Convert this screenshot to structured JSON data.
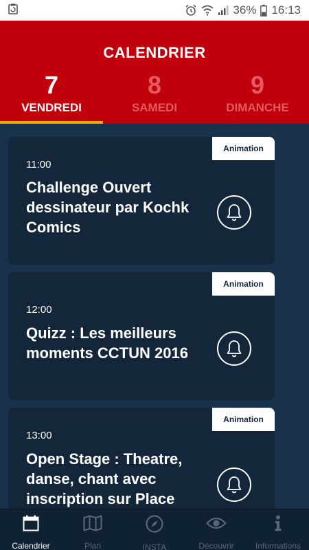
{
  "status_bar": {
    "battery": "36%",
    "time": "16:13"
  },
  "header": {
    "title": "CALENDRIER"
  },
  "tabs": [
    {
      "number": "7",
      "day": "VENDREDI"
    },
    {
      "number": "8",
      "day": "SAMEDI"
    },
    {
      "number": "9",
      "day": "DIMANCHE"
    }
  ],
  "events": [
    {
      "badge": "Animation",
      "time": "11:00",
      "title": "Challenge Ouvert dessinateur par Kochk Comics"
    },
    {
      "badge": "Animation",
      "time": "12:00",
      "title": "Quizz : Les meilleurs moments CCTUN 2016"
    },
    {
      "badge": "Animation",
      "time": "13:00",
      "title": "Open Stage : Theatre, danse, chant avec inscription sur Place"
    }
  ],
  "bottom_nav": [
    {
      "label": "Calendrier",
      "icon": "calendar-icon"
    },
    {
      "label": "Plan",
      "icon": "map-icon"
    },
    {
      "label": "INSTA",
      "icon": "compass-icon"
    },
    {
      "label": "Découvrir",
      "icon": "eye-icon"
    },
    {
      "label": "Informations",
      "icon": "info-icon"
    }
  ],
  "colors": {
    "header": "#c0000b",
    "background": "#17324a",
    "card": "#14263a",
    "tab_underline": "#f2a900"
  }
}
